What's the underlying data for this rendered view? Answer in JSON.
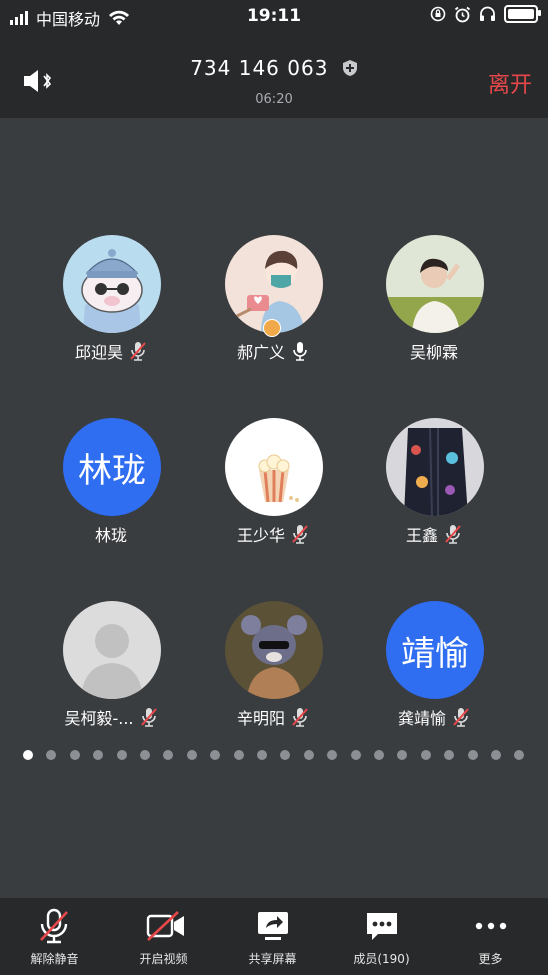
{
  "status_bar": {
    "carrier": "中国移动",
    "time": "19:11"
  },
  "header": {
    "meeting_id": "734 146 063",
    "duration": "06:20",
    "leave_label": "离开"
  },
  "participants": [
    {
      "name": "邱迎昊",
      "mic": "muted",
      "avatar": "pig-cartoon-avatar"
    },
    {
      "name": "郝广义",
      "mic": "on",
      "host": true,
      "avatar": "illustrated-boy-avatar"
    },
    {
      "name": "吴柳霖",
      "mic": "none",
      "avatar": "photo-person-avatar"
    },
    {
      "name": "林珑",
      "mic": "none",
      "avatar_text": "林珑"
    },
    {
      "name": "王少华",
      "mic": "muted",
      "avatar": "popcorn-avatar"
    },
    {
      "name": "王鑫",
      "mic": "muted",
      "avatar": "jacket-photo-avatar"
    },
    {
      "name": "吴柯毅-...",
      "mic": "muted",
      "avatar": "default-person-avatar"
    },
    {
      "name": "辛明阳",
      "mic": "muted",
      "avatar": "cartoon-rat-avatar"
    },
    {
      "name": "龚靖愉",
      "mic": "muted",
      "avatar_text": "靖愉"
    }
  ],
  "pagination": {
    "total": 22,
    "current": 1
  },
  "toolbar": {
    "unmute": "解除静音",
    "start_video": "开启视频",
    "share_screen": "共享屏幕",
    "members": "成员(190)",
    "more": "更多"
  },
  "colors": {
    "accent_blue": "#2f6df1",
    "leave_red": "#e8484a",
    "host_badge": "#f1a94a"
  }
}
